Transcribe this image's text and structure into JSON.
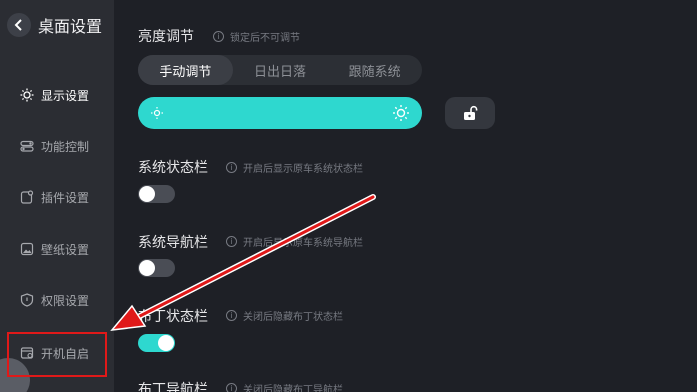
{
  "header": {
    "title": "桌面设置"
  },
  "sidebar": {
    "items": [
      {
        "label": "显示设置"
      },
      {
        "label": "功能控制"
      },
      {
        "label": "插件设置"
      },
      {
        "label": "壁纸设置"
      },
      {
        "label": "权限设置"
      },
      {
        "label": "开机自启"
      }
    ],
    "active_index": 0
  },
  "brightness": {
    "title": "亮度调节",
    "hint": "锁定后不可调节",
    "modes": [
      "手动调节",
      "日出日落",
      "跟随系统"
    ],
    "active_mode": "手动调节",
    "level": 1.0
  },
  "settings": [
    {
      "title": "系统状态栏",
      "hint": "开启后显示原车系统状态栏",
      "enabled": false
    },
    {
      "title": "系统导航栏",
      "hint": "开启后显示原车系统导航栏",
      "enabled": false
    },
    {
      "title": "布丁状态栏",
      "hint": "关闭后隐藏布丁状态栏",
      "enabled": true
    },
    {
      "title": "布丁导航栏",
      "hint": "关闭后隐藏布丁导航栏",
      "enabled": true
    }
  ],
  "colors": {
    "accent": "#2ed8cf",
    "annotation": "#e01919",
    "background": "#1e2026",
    "sidebar": "#2b2d33"
  },
  "icons": [
    "back-icon",
    "sun-icon",
    "toggle-icon",
    "plugin-icon",
    "image-icon",
    "shield-icon",
    "boot-icon",
    "info-icon",
    "unlock-icon"
  ]
}
